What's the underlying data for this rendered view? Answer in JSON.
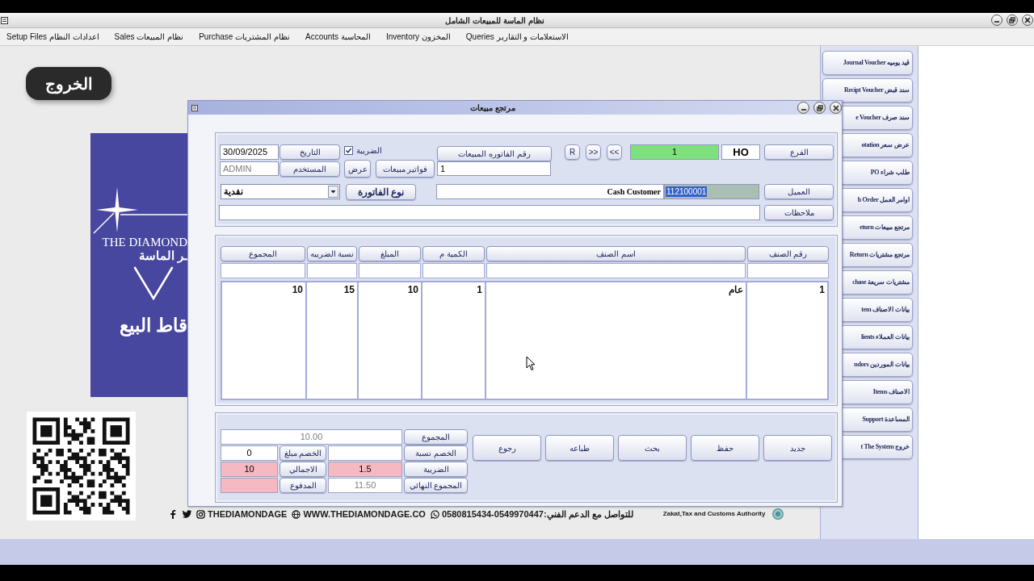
{
  "window": {
    "title": "نظام الماسة للمبيعات الشامل"
  },
  "menu": [
    "Queries الاستعلامات و التقارير",
    "Inventory المخزون",
    "Accounts المحاسبة",
    "Purchase نظام المشتريات",
    "Sales نظام المبيعات",
    "Setup Files اعدادات النظام"
  ],
  "desktop": {
    "exit_button": "الخروج",
    "logo": {
      "title": "THE DIAMOND",
      "subtitle": "ـر الماسة",
      "caption": "قاط البيع"
    },
    "footer": {
      "handle": "THEDIAMONDAGE",
      "website": "WWW.THEDIAMONDAGE.CO",
      "support": "0580815434-0549970447:للتواصل مع الدعم الفني",
      "authority": "Zakat,Tax and Customs Authority"
    }
  },
  "sidebar": {
    "buttons": [
      "Journal Voucher قيد يوميه",
      "Recipt Voucher سند قبض",
      "e Voucher سند صرف",
      "otation عرض سعر",
      "PO طلب شراء",
      "b Order اوامر العمل",
      "eturn مرتجع مبيعات",
      "Return مرتجع مشتريات",
      "chase مشتريات سريعة",
      "tem بيانات الاصناف",
      "lients بيانات العملاء",
      "ndors بيانات الموردين",
      "Items الاصناف",
      "Support المساعدة",
      "t The System خروج"
    ]
  },
  "dialog": {
    "title": "مرتجع مبيعات",
    "header": {
      "date": {
        "label": "التاريخ",
        "value": "30/09/2025",
        "disabled": false
      },
      "user": {
        "label": "المستخدم",
        "value": "ADMIN",
        "disabled": true
      },
      "tax": {
        "label": "الضريبة",
        "checked": true
      },
      "view_button": "عرض",
      "invoices_button": "فواتير مبيعات",
      "invoice_number": {
        "label": "رقم الفاتوره المبيعات",
        "value": "1"
      },
      "nav_buttons": [
        ">>",
        "<<",
        "R"
      ],
      "branch": {
        "label": "الفرع",
        "number": "1",
        "code": "HO"
      },
      "invoice_type": {
        "label": "نوع الفاتورة",
        "value": "نقدية"
      },
      "customer": {
        "label": "العميل",
        "name": "Cash Customer",
        "code": "112100001",
        "code_selected": true
      },
      "notes": {
        "label": "ملاحظات"
      }
    },
    "table": {
      "columns": [
        "رقم الصنف",
        "اسم الصنف",
        "الكمية م",
        "المبلغ",
        "نسبة الضريبه",
        "المجموع"
      ],
      "rows": [
        [
          "1",
          "عام",
          "1",
          "10",
          "15",
          "10"
        ]
      ]
    },
    "totals": [
      {
        "kind": "wide",
        "label": "المجموع",
        "value": "10.00",
        "disabled": true,
        "highlighted": false
      },
      {
        "kind": "pair",
        "label": "الخصم نسبة",
        "highlighted": false,
        "extra": {
          "label": "الخصم مبلغ",
          "value": "0",
          "disabled": false,
          "highlighted": false
        }
      },
      {
        "kind": "pair",
        "label": "الضريبة",
        "value": "1.5",
        "disabled": false,
        "highlighted": true,
        "extra": {
          "label": "الاجمالي",
          "value": "10",
          "disabled": false,
          "highlighted": true
        }
      },
      {
        "kind": "pair",
        "label": "المجموع النهائي",
        "value": "11.50",
        "disabled": true,
        "highlighted": false,
        "extra": {
          "label": "المدفوع",
          "highlighted": true
        }
      }
    ],
    "actions": [
      "جديد",
      "حفظ",
      "بحث",
      "طباعه",
      "رجوع"
    ]
  }
}
